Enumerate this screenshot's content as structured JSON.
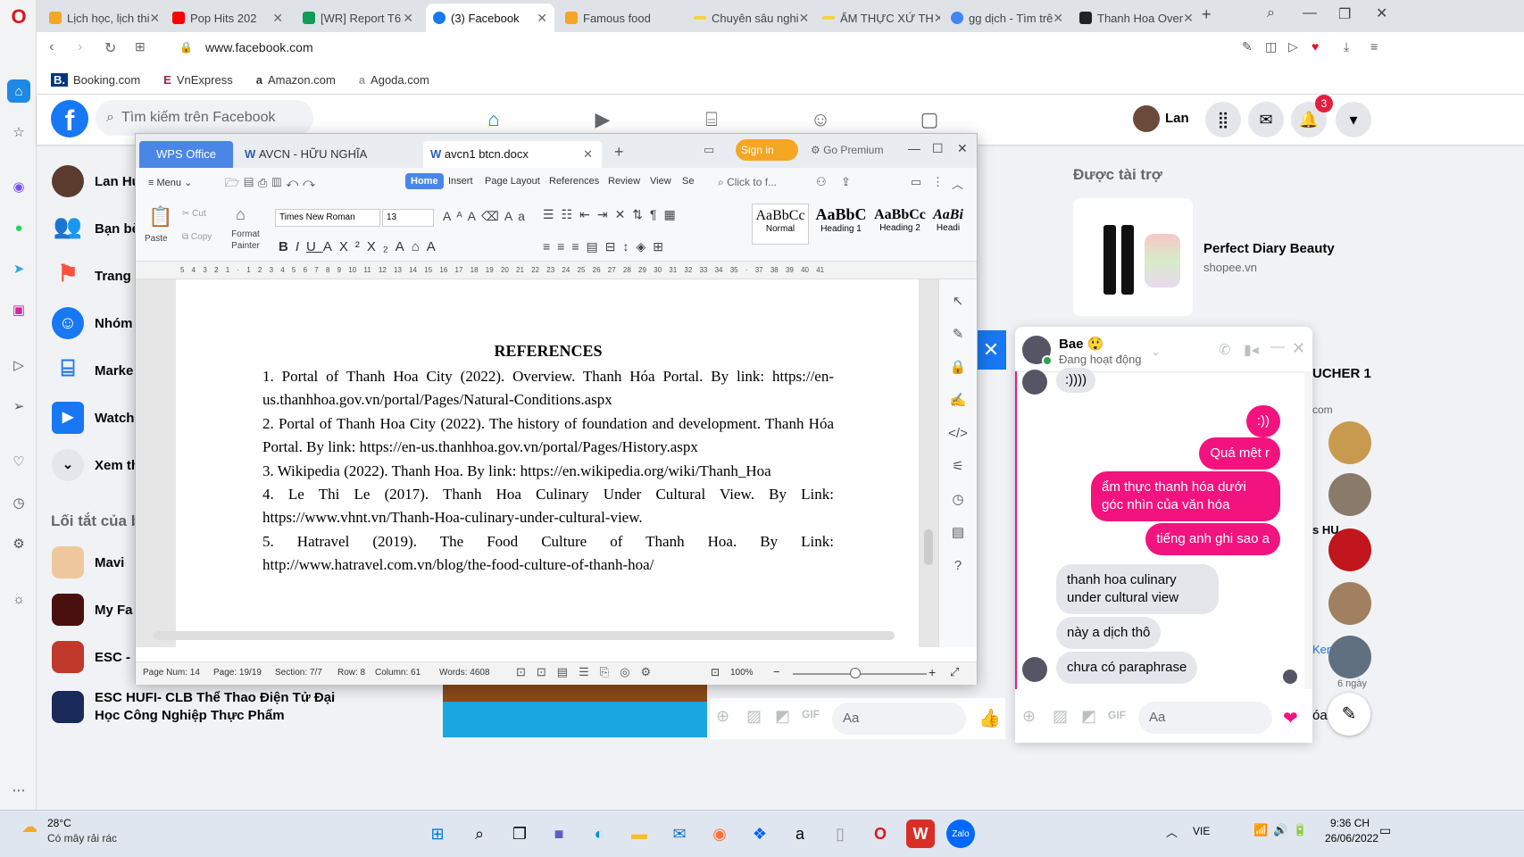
{
  "tabs": [
    {
      "label": "Lịch học, lịch thi",
      "color": "#f5a623"
    },
    {
      "label": "Pop Hits 202",
      "color": "#ff0000"
    },
    {
      "label": "[WR] Report T6",
      "color": "#0f9d58"
    },
    {
      "label": "(3) Facebook",
      "color": "#1877f2",
      "active": true
    },
    {
      "label": "Famous food",
      "color": "#f5a623"
    },
    {
      "label": "Chuyên sâu nghi",
      "color": "#f5d33a"
    },
    {
      "label": "ẨM THỰC XỨ TH",
      "color": "#f5d33a"
    },
    {
      "label": "gg dịch - Tìm trê",
      "color": "#4285f4"
    },
    {
      "label": "Thanh Hoa Over",
      "color": "#222222"
    }
  ],
  "address": "www.facebook.com",
  "bookmarks": [
    "Booking.com",
    "VnExpress",
    "Amazon.com",
    "Agoda.com"
  ],
  "fb": {
    "search_placeholder": "Tìm kiếm trên Facebook",
    "user": "Lan",
    "notif_count": "3",
    "left_items": [
      "Lan Hu",
      "Bạn bè",
      "Trang",
      "Nhóm",
      "Marke",
      "Watch",
      "Xem th"
    ],
    "shortcuts_title": "Lối tắt của b",
    "shortcuts": [
      "Mavi",
      "My Fa",
      "ESC - E",
      "ESC HUFI- CLB Thể Thao Điện Tử Đại Học Công Nghiệp Thực Phẩm"
    ],
    "sponsored_title": "Được tài trợ",
    "ad_title": "Perfect Diary Beauty",
    "ad_site": "shopee.vn",
    "side_labels": [
      "UCHER 1",
      "com",
      "s HU",
      "Ken",
      "6 ngày",
      "óa"
    ]
  },
  "wps": {
    "brand": "WPS Office",
    "doc_tab1": "AVCN - HỮU NGHĨA",
    "doc_tab2": "avcn1 btcn.docx",
    "signin": "Sign in",
    "premium": "Go Premium",
    "menu": "Menu",
    "ribbon_tabs": [
      "Home",
      "Insert",
      "Page Layout",
      "References",
      "Review",
      "View",
      "Se"
    ],
    "search": "Click to f...",
    "paste": "Paste",
    "cut": "Cut",
    "copy": "Copy",
    "format_painter": "Format Painter",
    "font": "Times New Roman",
    "size": "13",
    "styles": [
      {
        "preview": "AaBbCc",
        "name": "Normal"
      },
      {
        "preview": "AaBbC",
        "name": "Heading 1"
      },
      {
        "preview": "AaBbCc",
        "name": "Heading 2"
      },
      {
        "preview": "AaBi",
        "name": "Headi"
      }
    ],
    "ruler": "5 4 3 2 1 · 1 2 3 4 5 6 7 8 9 10 11 12 13 14 15 16 17 18 19 20 21 22 23 24 25 26 27 28 29 30 31 32 33 34 35 · 37 38 39 40 41",
    "heading": "REFERENCES",
    "refs": [
      "1. Portal of Thanh Hoa City (2022). Overview. Thanh Hóa Portal. By link: https://en-us.thanhhoa.gov.vn/portal/Pages/Natural-Conditions.aspx",
      "2. Portal of Thanh Hoa City (2022). The history of foundation and development. Thanh Hóa Portal. By link: https://en-us.thanhhoa.gov.vn/portal/Pages/History.aspx",
      "3. Wikipedia (2022). Thanh Hoa. By link: https://en.wikipedia.org/wiki/Thanh_Hoa",
      "4. Le Thi Le (2017). Thanh Hoa Culinary Under Cultural View. By Link: https://www.vhnt.vn/Thanh-Hoa-culinary-under-cultural-view.",
      "5. Hatravel (2019). The Food Culture of Thanh Hoa. By Link: http://www.hatravel.com.vn/blog/the-food-culture-of-thanh-hoa/"
    ],
    "status": {
      "page_num": "Page Num: 14",
      "page": "Page: 19/19",
      "section": "Section: 7/7",
      "row": "Row: 8",
      "column": "Column: 61",
      "words": "Words: 4608",
      "zoom": "100%"
    }
  },
  "chat": {
    "name": "Bae 😲",
    "status": "Đang hoạt động",
    "messages": [
      {
        "from": "them",
        "text": ":))))"
      },
      {
        "from": "me",
        "text": ":))"
      },
      {
        "from": "me",
        "text": "Quá mệt r"
      },
      {
        "from": "me",
        "text": "ẩm thực thanh hóa dưới góc nhìn của văn hóa"
      },
      {
        "from": "me",
        "text": "tiếng anh ghi sao a"
      },
      {
        "from": "them",
        "text": "thanh hoa culinary under cultural view"
      },
      {
        "from": "them",
        "text": "này a dịch thô"
      },
      {
        "from": "them",
        "text": "chưa có paraphrase"
      }
    ],
    "input_placeholder": "Aa",
    "input_placeholder2": "Aa"
  },
  "taskbar": {
    "temp": "28°C",
    "weather": "Có mây rải rác",
    "lang": "VIE",
    "time": "9:36 CH",
    "date": "26/06/2022"
  }
}
